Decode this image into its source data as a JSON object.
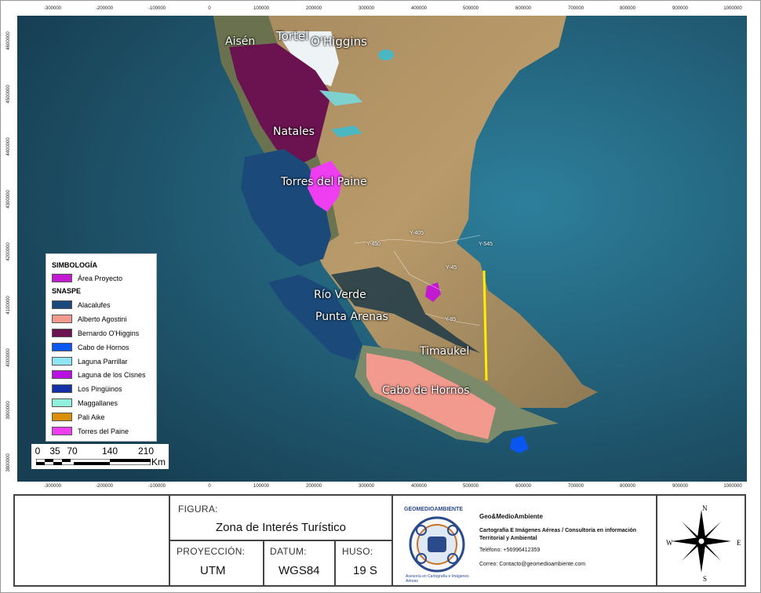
{
  "axis": {
    "x_ticks": [
      "-300000",
      "-200000",
      "-100000",
      "0",
      "100000",
      "200000",
      "300000",
      "400000",
      "500000",
      "600000",
      "700000",
      "800000",
      "900000",
      "1000000"
    ],
    "y_ticks": [
      "4600000",
      "4500000",
      "4400000",
      "4300000",
      "4200000",
      "4100000",
      "4000000",
      "3900000",
      "3800000"
    ]
  },
  "map": {
    "places": [
      "Aisén",
      "Tortel",
      "O'Higgins",
      "Natales",
      "Torres del Paine",
      "Río Verde",
      "Punta Arenas",
      "Timaukel",
      "Cabo de Hornos"
    ],
    "roads": [
      "Y-405",
      "Y-450",
      "Y-545",
      "Y-45",
      "Y-85"
    ]
  },
  "legend": {
    "title": "SIMBOLOGÍA",
    "project_label": "Área Proyecto",
    "project_color": "#c21ad1",
    "section_title": "SNASPE",
    "items": [
      {
        "label": "Alacalufes",
        "color": "#1b4a7a"
      },
      {
        "label": "Alberto Agostini",
        "color": "#f39a8e"
      },
      {
        "label": "Bernardo O'Higgins",
        "color": "#6a1350"
      },
      {
        "label": "Cabo de Hornos",
        "color": "#0a56f0"
      },
      {
        "label": "Laguna Parrillar",
        "color": "#8fe6f2"
      },
      {
        "label": "Laguna de los Cisnes",
        "color": "#b710e0"
      },
      {
        "label": "Los Pingüinos",
        "color": "#1330a6"
      },
      {
        "label": "Maggallanes",
        "color": "#8ff0dc"
      },
      {
        "label": "Pali Aike",
        "color": "#d98f0a"
      },
      {
        "label": "Torres del Paine",
        "color": "#ef3ef2"
      }
    ]
  },
  "scalebar": {
    "labels": [
      "0",
      "35",
      "70",
      "140",
      "210"
    ],
    "unit": "Km"
  },
  "footer": {
    "figura_label": "FIGURA:",
    "figura_value": "Zona de Interés Turístico",
    "proyeccion_label": "PROYECCIÓN:",
    "proyeccion_value": "UTM",
    "datum_label": "DATUM:",
    "datum_value": "WGS84",
    "huso_label": "HUSO:",
    "huso_value": "19 S",
    "logo_text": "GEOMEDIOAMBIENTE",
    "logo_subtext": "Asesoría en Cartografía e Imágenes Aéreas",
    "company_name": "Geo&MedioAmbiente",
    "company_desc": "Cartografía E Imágenes Aéreas / Consultoría en información Territorial y Ambiental",
    "phone": "Teléfono: +56996412359",
    "email": "Correo: Contacto@geomedioambiente.com"
  },
  "compass": {
    "n": "N",
    "s": "S",
    "e": "E",
    "w": "W"
  }
}
